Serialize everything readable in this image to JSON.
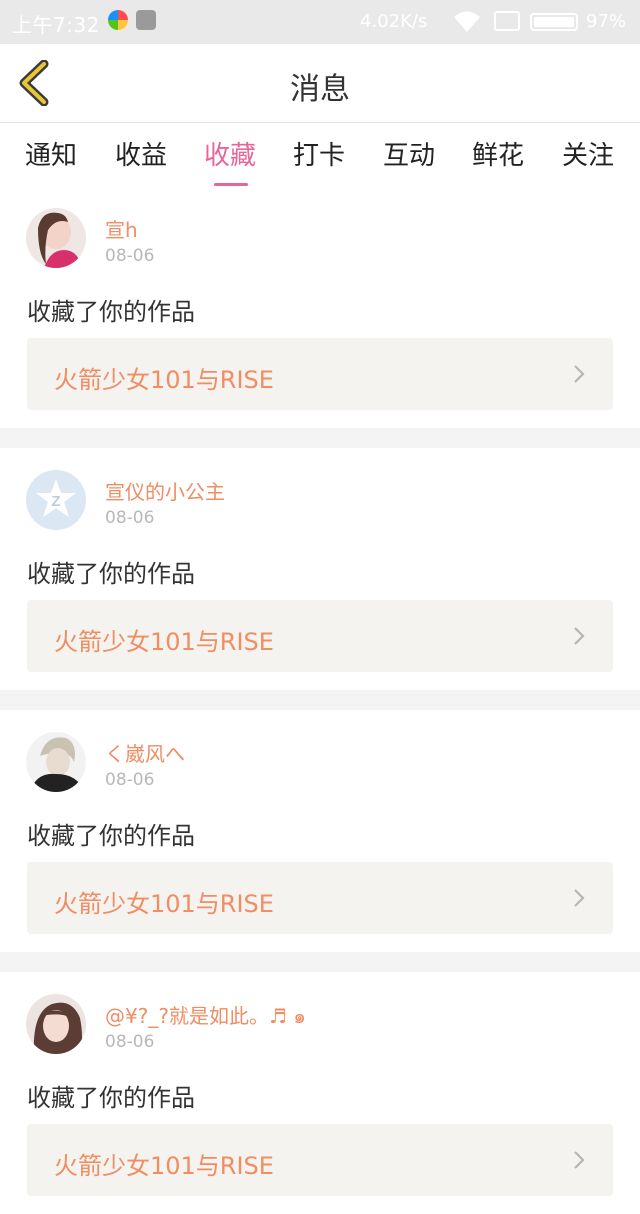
{
  "status_bar": {
    "time": "上午7:32",
    "net_speed": "4.02K/s",
    "battery": "97%",
    "icons": [
      "app-icon-colorful",
      "app-icon-gray",
      "wifi-icon",
      "sim-icon",
      "battery-icon"
    ]
  },
  "header": {
    "title": "消息",
    "back_icon": "chevron-left-icon"
  },
  "tabs": [
    {
      "label": "通知"
    },
    {
      "label": "收益"
    },
    {
      "label": "收藏",
      "active": true
    },
    {
      "label": "打卡"
    },
    {
      "label": "互动"
    },
    {
      "label": "鲜花"
    },
    {
      "label": "关注"
    }
  ],
  "colors": {
    "accent_pink": "#e6669a",
    "name_orange": "#ef8d63",
    "card_bg": "#f4f3ef",
    "back_arrow": "#e9c634"
  },
  "items": [
    {
      "user": "宣h",
      "date": "08-06",
      "action": "收藏了你的作品",
      "work": "火箭少女101与RISE"
    },
    {
      "user": "宣仪的小公主",
      "date": "08-06",
      "action": "收藏了你的作品",
      "work": "火箭少女101与RISE"
    },
    {
      "user": "く崴风へ",
      "date": "08-06",
      "action": "收藏了你的作品",
      "work": "火箭少女101与RISE"
    },
    {
      "user": "@¥?_?就是如此。♬ ๑",
      "date": "08-06",
      "action": "收藏了你的作品",
      "work": "火箭少女101与RISE"
    }
  ]
}
